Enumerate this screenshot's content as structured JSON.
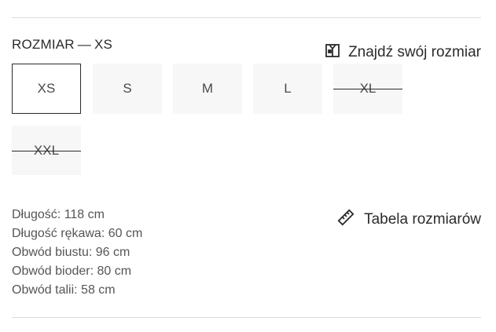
{
  "size_selector": {
    "label": "ROZMIAR",
    "selected": "XS",
    "options": [
      {
        "label": "XS",
        "state": "selected"
      },
      {
        "label": "S",
        "state": "available"
      },
      {
        "label": "M",
        "state": "available"
      },
      {
        "label": "L",
        "state": "available"
      },
      {
        "label": "XL",
        "state": "unavailable"
      },
      {
        "label": "XXL",
        "state": "unavailable"
      }
    ]
  },
  "finder_link": {
    "label": "Znajdź swój rozmiar",
    "icon": "shirt-icon"
  },
  "size_chart_link": {
    "label": "Tabela rozmiarów",
    "icon": "ruler-icon"
  },
  "measurements": [
    "Długość: 118 cm",
    "Długość rękawa: 60 cm",
    "Obwód biustu: 96 cm",
    "Obwód bioder: 80 cm",
    "Obwód talii: 58 cm"
  ]
}
